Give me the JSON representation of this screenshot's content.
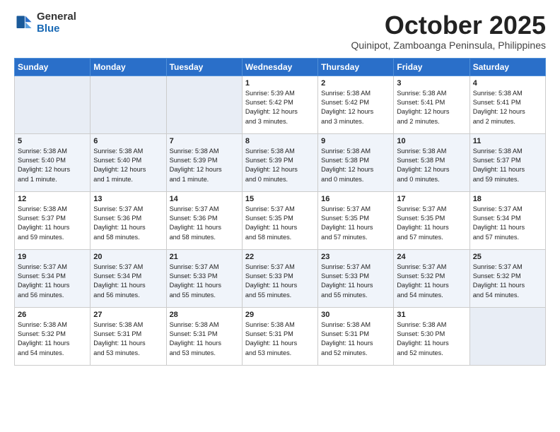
{
  "logo": {
    "general": "General",
    "blue": "Blue"
  },
  "title": "October 2025",
  "subtitle": "Quinipot, Zamboanga Peninsula, Philippines",
  "days_header": [
    "Sunday",
    "Monday",
    "Tuesday",
    "Wednesday",
    "Thursday",
    "Friday",
    "Saturday"
  ],
  "weeks": [
    [
      {
        "num": "",
        "info": ""
      },
      {
        "num": "",
        "info": ""
      },
      {
        "num": "",
        "info": ""
      },
      {
        "num": "1",
        "info": "Sunrise: 5:39 AM\nSunset: 5:42 PM\nDaylight: 12 hours\nand 3 minutes."
      },
      {
        "num": "2",
        "info": "Sunrise: 5:38 AM\nSunset: 5:42 PM\nDaylight: 12 hours\nand 3 minutes."
      },
      {
        "num": "3",
        "info": "Sunrise: 5:38 AM\nSunset: 5:41 PM\nDaylight: 12 hours\nand 2 minutes."
      },
      {
        "num": "4",
        "info": "Sunrise: 5:38 AM\nSunset: 5:41 PM\nDaylight: 12 hours\nand 2 minutes."
      }
    ],
    [
      {
        "num": "5",
        "info": "Sunrise: 5:38 AM\nSunset: 5:40 PM\nDaylight: 12 hours\nand 1 minute."
      },
      {
        "num": "6",
        "info": "Sunrise: 5:38 AM\nSunset: 5:40 PM\nDaylight: 12 hours\nand 1 minute."
      },
      {
        "num": "7",
        "info": "Sunrise: 5:38 AM\nSunset: 5:39 PM\nDaylight: 12 hours\nand 1 minute."
      },
      {
        "num": "8",
        "info": "Sunrise: 5:38 AM\nSunset: 5:39 PM\nDaylight: 12 hours\nand 0 minutes."
      },
      {
        "num": "9",
        "info": "Sunrise: 5:38 AM\nSunset: 5:38 PM\nDaylight: 12 hours\nand 0 minutes."
      },
      {
        "num": "10",
        "info": "Sunrise: 5:38 AM\nSunset: 5:38 PM\nDaylight: 12 hours\nand 0 minutes."
      },
      {
        "num": "11",
        "info": "Sunrise: 5:38 AM\nSunset: 5:37 PM\nDaylight: 11 hours\nand 59 minutes."
      }
    ],
    [
      {
        "num": "12",
        "info": "Sunrise: 5:38 AM\nSunset: 5:37 PM\nDaylight: 11 hours\nand 59 minutes."
      },
      {
        "num": "13",
        "info": "Sunrise: 5:37 AM\nSunset: 5:36 PM\nDaylight: 11 hours\nand 58 minutes."
      },
      {
        "num": "14",
        "info": "Sunrise: 5:37 AM\nSunset: 5:36 PM\nDaylight: 11 hours\nand 58 minutes."
      },
      {
        "num": "15",
        "info": "Sunrise: 5:37 AM\nSunset: 5:35 PM\nDaylight: 11 hours\nand 58 minutes."
      },
      {
        "num": "16",
        "info": "Sunrise: 5:37 AM\nSunset: 5:35 PM\nDaylight: 11 hours\nand 57 minutes."
      },
      {
        "num": "17",
        "info": "Sunrise: 5:37 AM\nSunset: 5:35 PM\nDaylight: 11 hours\nand 57 minutes."
      },
      {
        "num": "18",
        "info": "Sunrise: 5:37 AM\nSunset: 5:34 PM\nDaylight: 11 hours\nand 57 minutes."
      }
    ],
    [
      {
        "num": "19",
        "info": "Sunrise: 5:37 AM\nSunset: 5:34 PM\nDaylight: 11 hours\nand 56 minutes."
      },
      {
        "num": "20",
        "info": "Sunrise: 5:37 AM\nSunset: 5:34 PM\nDaylight: 11 hours\nand 56 minutes."
      },
      {
        "num": "21",
        "info": "Sunrise: 5:37 AM\nSunset: 5:33 PM\nDaylight: 11 hours\nand 55 minutes."
      },
      {
        "num": "22",
        "info": "Sunrise: 5:37 AM\nSunset: 5:33 PM\nDaylight: 11 hours\nand 55 minutes."
      },
      {
        "num": "23",
        "info": "Sunrise: 5:37 AM\nSunset: 5:33 PM\nDaylight: 11 hours\nand 55 minutes."
      },
      {
        "num": "24",
        "info": "Sunrise: 5:37 AM\nSunset: 5:32 PM\nDaylight: 11 hours\nand 54 minutes."
      },
      {
        "num": "25",
        "info": "Sunrise: 5:37 AM\nSunset: 5:32 PM\nDaylight: 11 hours\nand 54 minutes."
      }
    ],
    [
      {
        "num": "26",
        "info": "Sunrise: 5:38 AM\nSunset: 5:32 PM\nDaylight: 11 hours\nand 54 minutes."
      },
      {
        "num": "27",
        "info": "Sunrise: 5:38 AM\nSunset: 5:31 PM\nDaylight: 11 hours\nand 53 minutes."
      },
      {
        "num": "28",
        "info": "Sunrise: 5:38 AM\nSunset: 5:31 PM\nDaylight: 11 hours\nand 53 minutes."
      },
      {
        "num": "29",
        "info": "Sunrise: 5:38 AM\nSunset: 5:31 PM\nDaylight: 11 hours\nand 53 minutes."
      },
      {
        "num": "30",
        "info": "Sunrise: 5:38 AM\nSunset: 5:31 PM\nDaylight: 11 hours\nand 52 minutes."
      },
      {
        "num": "31",
        "info": "Sunrise: 5:38 AM\nSunset: 5:30 PM\nDaylight: 11 hours\nand 52 minutes."
      },
      {
        "num": "",
        "info": ""
      }
    ]
  ]
}
